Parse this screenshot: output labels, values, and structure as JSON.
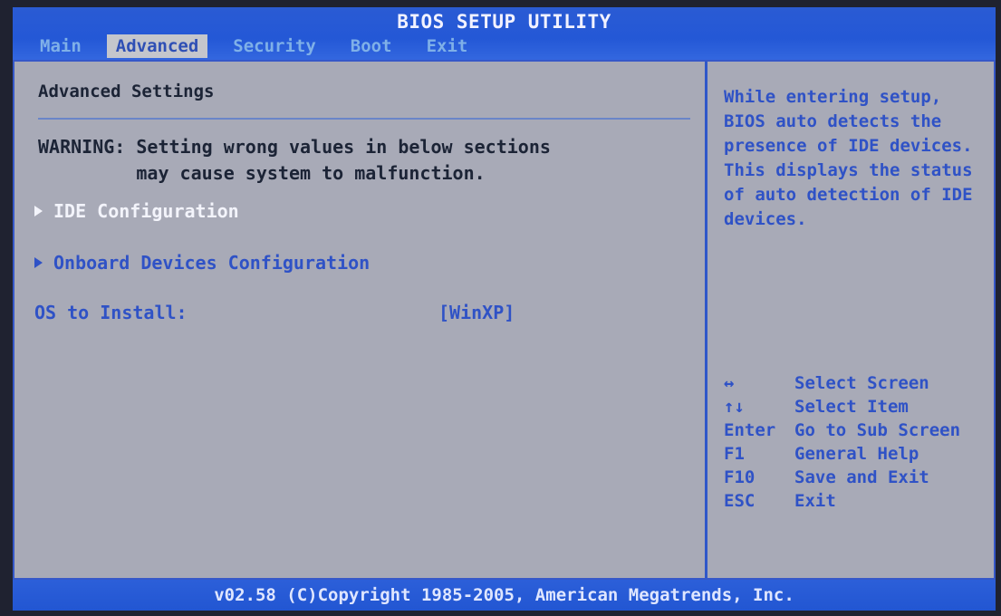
{
  "app_title": "BIOS SETUP UTILITY",
  "tabs": [
    {
      "label": "Main"
    },
    {
      "label": "Advanced"
    },
    {
      "label": "Security"
    },
    {
      "label": "Boot"
    },
    {
      "label": "Exit"
    }
  ],
  "active_tab": "Advanced",
  "main": {
    "heading": "Advanced Settings",
    "warning": "WARNING: Setting wrong values in below sections\n         may cause system to malfunction.",
    "items": [
      {
        "label": "IDE Configuration"
      },
      {
        "label": "Onboard Devices Configuration"
      }
    ],
    "os_install": {
      "label": "OS to Install:",
      "value": "[WinXP]"
    }
  },
  "help_text": "While entering setup, BIOS auto detects the presence of IDE devices. This displays the status of auto detection of IDE devices.",
  "keys": [
    {
      "key": "↔",
      "action": "Select Screen"
    },
    {
      "key": "↑↓",
      "action": "Select Item"
    },
    {
      "key": "Enter",
      "action": "Go to Sub Screen"
    },
    {
      "key": "F1",
      "action": "General Help"
    },
    {
      "key": "F10",
      "action": "Save and Exit"
    },
    {
      "key": "ESC",
      "action": "Exit"
    }
  ],
  "footer": "v02.58 (C)Copyright 1985-2005, American Megatrends, Inc.",
  "colors": {
    "title_bar": "#2458d6",
    "panel_bg": "#a8aab7",
    "highlight_text": "#f3f4fb",
    "item_text": "#2f52c6"
  }
}
